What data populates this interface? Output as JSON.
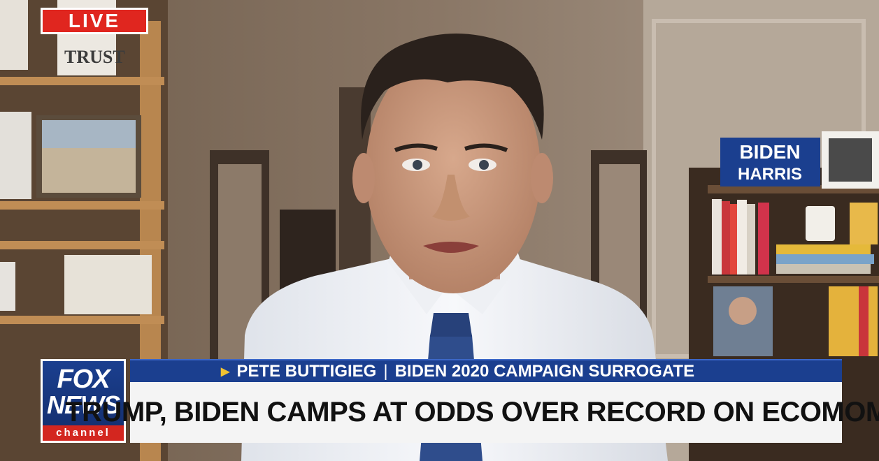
{
  "live_badge": "LIVE",
  "logo": {
    "line1": "FOX",
    "line2": "NEWS",
    "line3": "channel"
  },
  "lower_third": {
    "name": "PETE BUTTIGIEG",
    "role": "BIDEN 2020 CAMPAIGN SURROGATE",
    "headline": "TRUMP, BIDEN CAMPS AT ODDS OVER RECORD ON ECOMOMY"
  },
  "background": {
    "sign_line1": "BIDEN",
    "sign_line2": "HARRIS",
    "shelf_sign": "TRUST"
  },
  "colors": {
    "brand_blue": "#1b3f8f",
    "live_red": "#e0261f",
    "accent_yellow": "#f1c232"
  }
}
